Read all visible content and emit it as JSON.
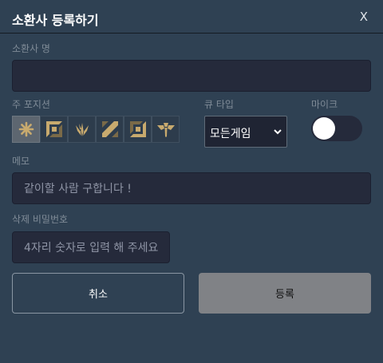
{
  "modal": {
    "title": "소환사 등록하기",
    "close_label": "X"
  },
  "summoner_name": {
    "label": "소환사 명",
    "value": ""
  },
  "position": {
    "label": "주 포지션",
    "buttons": [
      {
        "icon": "all-positions-icon",
        "active": true
      },
      {
        "icon": "top-lane-icon",
        "active": false
      },
      {
        "icon": "jungle-icon",
        "active": false
      },
      {
        "icon": "mid-lane-icon",
        "active": false
      },
      {
        "icon": "bottom-lane-icon",
        "active": false
      },
      {
        "icon": "support-icon",
        "active": false
      }
    ]
  },
  "queue_type": {
    "label": "큐 타입",
    "selected": "모든게임"
  },
  "mic": {
    "label": "마이크",
    "enabled": false
  },
  "memo": {
    "label": "메모",
    "placeholder": "같이할 사람 구합니다 !"
  },
  "delete_password": {
    "label": "삭제 비밀번호",
    "placeholder": "4자리 숫자로 입력 해 주세요"
  },
  "actions": {
    "cancel_label": "취소",
    "submit_label": "등록"
  },
  "colors": {
    "background": "#2f4153",
    "input": "#252a3b",
    "icon_gold": "#c8aa6e",
    "submit": "#808286"
  }
}
